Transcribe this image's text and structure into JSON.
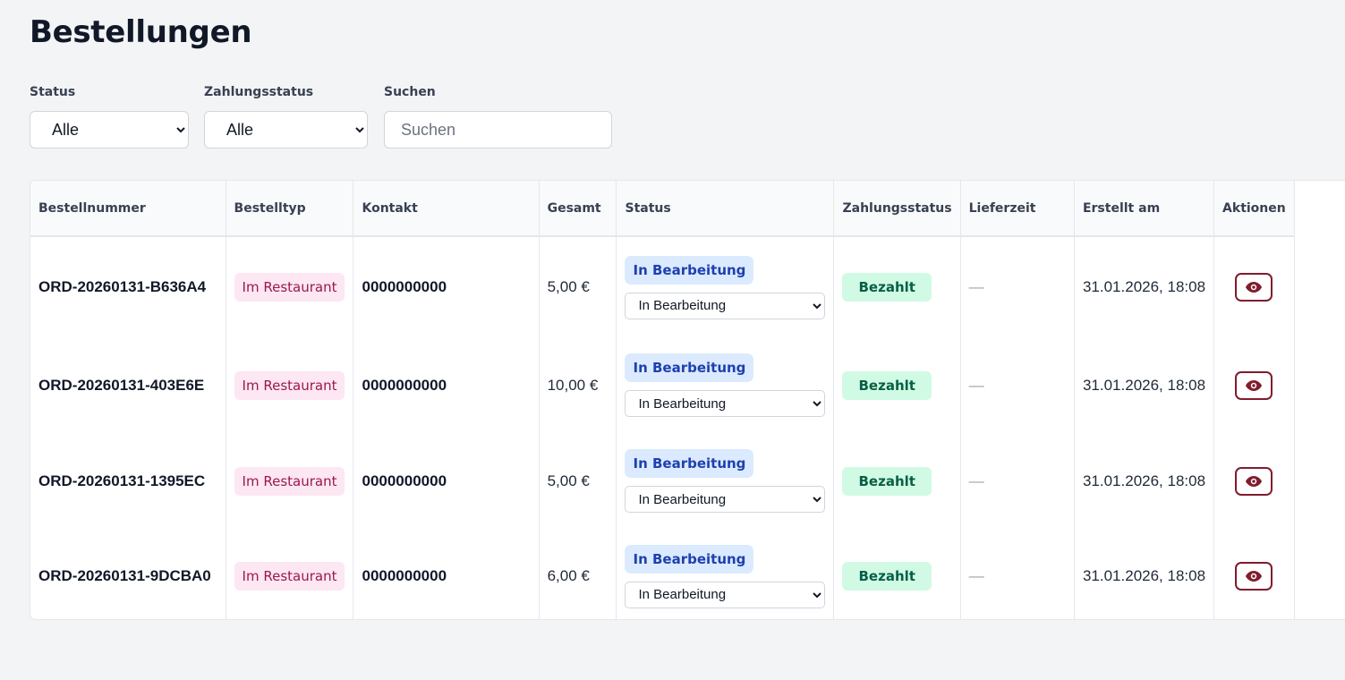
{
  "page": {
    "title": "Bestellungen"
  },
  "filters": {
    "status": {
      "label": "Status",
      "value": "Alle",
      "options": [
        "Alle"
      ]
    },
    "payment_status": {
      "label": "Zahlungsstatus",
      "value": "Alle",
      "options": [
        "Alle"
      ]
    },
    "search": {
      "label": "Suchen",
      "placeholder": "Suchen",
      "value": ""
    }
  },
  "table": {
    "columns": [
      "Bestellnummer",
      "Bestelltyp",
      "Kontakt",
      "Gesamt",
      "Status",
      "Zahlungsstatus",
      "Lieferzeit",
      "Erstellt am",
      "Aktionen"
    ],
    "rows": [
      {
        "order_no": "ORD-20260131-B636A4",
        "type": "Im Restaurant",
        "contact": "0000000000",
        "total": "5,00 €",
        "status_badge": "In Bearbeitung",
        "status_select": "In Bearbeitung",
        "payment": "Bezahlt",
        "delivery": "—",
        "created": "31.01.2026, 18:08"
      },
      {
        "order_no": "ORD-20260131-403E6E",
        "type": "Im Restaurant",
        "contact": "0000000000",
        "total": "10,00 €",
        "status_badge": "In Bearbeitung",
        "status_select": "In Bearbeitung",
        "payment": "Bezahlt",
        "delivery": "—",
        "created": "31.01.2026, 18:08"
      },
      {
        "order_no": "ORD-20260131-1395EC",
        "type": "Im Restaurant",
        "contact": "0000000000",
        "total": "5,00 €",
        "status_badge": "In Bearbeitung",
        "status_select": "In Bearbeitung",
        "payment": "Bezahlt",
        "delivery": "—",
        "created": "31.01.2026, 18:08"
      },
      {
        "order_no": "ORD-20260131-9DCBA0",
        "type": "Im Restaurant",
        "contact": "0000000000",
        "total": "6,00 €",
        "status_badge": "In Bearbeitung",
        "status_select": "In Bearbeitung",
        "payment": "Bezahlt",
        "delivery": "—",
        "created": "31.01.2026, 18:08"
      }
    ]
  },
  "icons": {
    "view": "eye-icon"
  },
  "colors": {
    "background": "#f3f4f6",
    "type_badge_bg": "#fce7f3",
    "type_badge_fg": "#9d174d",
    "status_badge_bg": "#dbeafe",
    "status_badge_fg": "#1e40af",
    "pay_badge_bg": "#d1fae5",
    "pay_badge_fg": "#065f46",
    "action_accent": "#7f1d2d"
  }
}
